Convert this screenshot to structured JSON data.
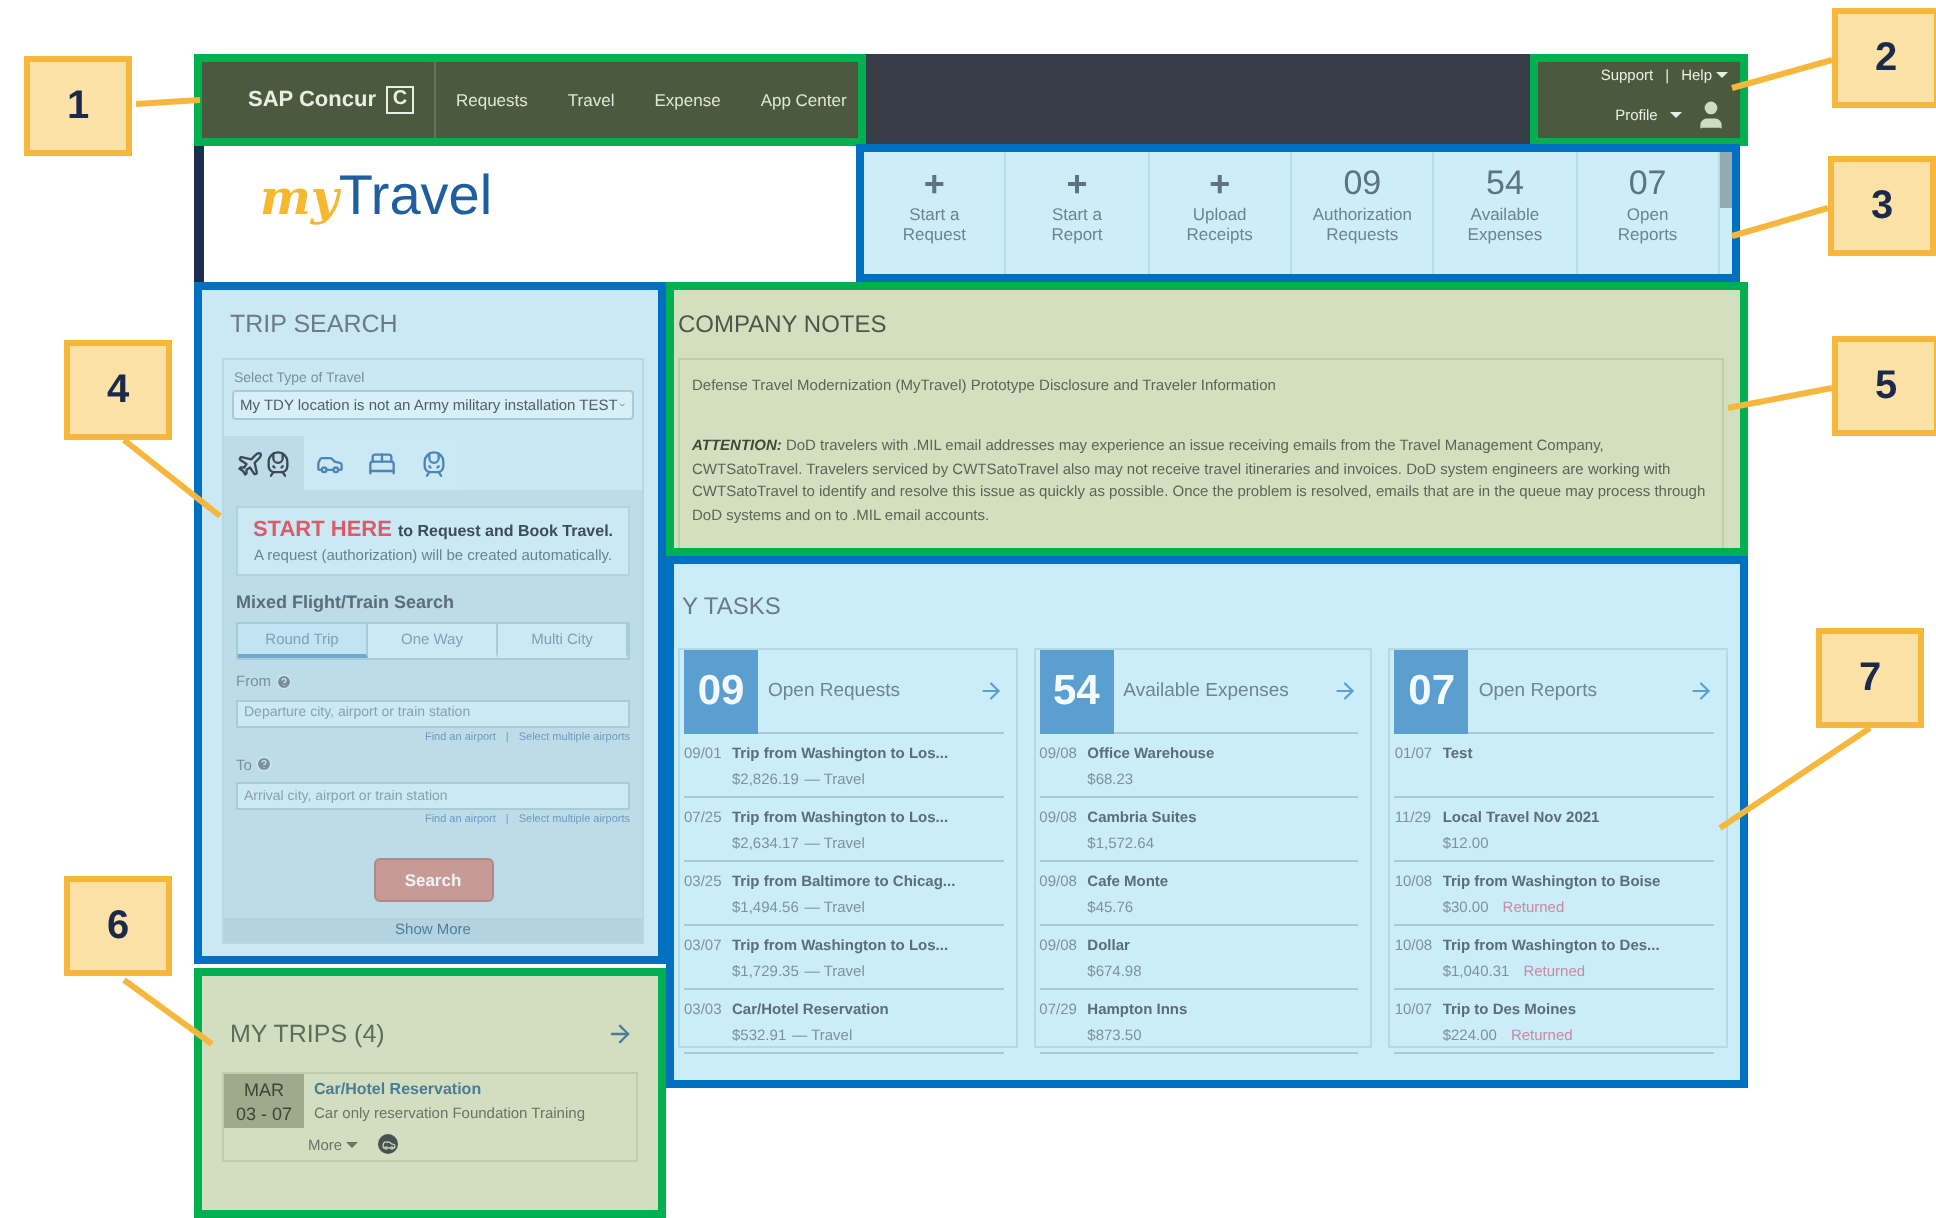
{
  "header": {
    "brand": "SAP Concur",
    "brand_mark": "C",
    "nav": [
      {
        "label": "Requests"
      },
      {
        "label": "Travel"
      },
      {
        "label": "Expense"
      },
      {
        "label": "App Center"
      }
    ],
    "support": "Support",
    "separator": "|",
    "help": "Help",
    "profile": "Profile"
  },
  "logo": {
    "script": "my",
    "word": "Travel"
  },
  "quick_actions": [
    {
      "kind": "add",
      "value": "+",
      "label": [
        "Start a",
        "Request"
      ]
    },
    {
      "kind": "add",
      "value": "+",
      "label": [
        "Start a",
        "Report"
      ]
    },
    {
      "kind": "add",
      "value": "+",
      "label": [
        "Upload",
        "Receipts"
      ]
    },
    {
      "kind": "count",
      "value": "09",
      "label": [
        "Authorization",
        "Requests"
      ]
    },
    {
      "kind": "count",
      "value": "54",
      "label": [
        "Available",
        "Expenses"
      ]
    },
    {
      "kind": "count",
      "value": "07",
      "label": [
        "Open",
        "Reports"
      ]
    }
  ],
  "trip_search": {
    "title": "TRIP SEARCH",
    "type_label": "Select Type of Travel",
    "type_value": "My TDY location is not an Army military installation TEST",
    "modes": [
      {
        "kind": "flight-train",
        "selected": true
      },
      {
        "kind": "car",
        "selected": false
      },
      {
        "kind": "hotel",
        "selected": false
      },
      {
        "kind": "train",
        "selected": false
      }
    ],
    "banner_title": "START HERE",
    "banner_text": "to Request and Book Travel.",
    "banner_note": "A request (authorization) will be created automatically.",
    "subtitle": "Mixed Flight/Train Search",
    "trip_types": [
      {
        "label": "Round Trip",
        "selected": true
      },
      {
        "label": "One Way",
        "selected": false
      },
      {
        "label": "Multi City",
        "selected": false
      }
    ],
    "fields": [
      {
        "label": "From",
        "placeholder": "Departure city, airport or train station",
        "link_1": "Find an airport",
        "separator": "|",
        "link_2": "Select multiple airports"
      },
      {
        "label": "To",
        "placeholder": "Arrival city, airport or train station",
        "link_1": "Find an airport",
        "separator": "|",
        "link_2": "Select multiple airports"
      }
    ],
    "search": "Search",
    "show_more": "Show More"
  },
  "company_notes": {
    "title": "COMPANY NOTES",
    "heading": "Defense Travel Modernization (MyTravel) Prototype Disclosure and Traveler Information",
    "body": "**ATTENTION:** DoD travelers with .MIL email addresses may experience an issue receiving emails from the Travel Management Company, CWTSatoTravel.  Travelers serviced by CWTSatoTravel also may not receive travel itineraries and invoices. DoD system engineers are working with CWTSatoTravel to identify and resolve this issue as quickly as possible. Once the problem is resolved, emails that are in the queue may process through DoD systems and on to .MIL email accounts."
  },
  "tasks": {
    "title": "Y TASKS",
    "cards": [
      {
        "count": "09",
        "title": "Open Requests",
        "items": [
          {
            "date": "09/01",
            "title": "Trip from Washington to Los...",
            "amount": "$2,826.19",
            "note": "— Travel"
          },
          {
            "date": "07/25",
            "title": "Trip from Washington to Los...",
            "amount": "$2,634.17",
            "note": "— Travel"
          },
          {
            "date": "03/25",
            "title": "Trip from Baltimore to Chicag...",
            "amount": "$1,494.56",
            "note": "— Travel"
          },
          {
            "date": "03/07",
            "title": "Trip from Washington to Los...",
            "amount": "$1,729.35",
            "note": "— Travel"
          },
          {
            "date": "03/03",
            "title": "Car/Hotel Reservation",
            "amount": "$532.91",
            "note": "— Travel"
          }
        ]
      },
      {
        "count": "54",
        "title": "Available Expenses",
        "items": [
          {
            "date": "09/08",
            "title": "Office Warehouse",
            "amount": "$68.23"
          },
          {
            "date": "09/08",
            "title": "Cambria Suites",
            "amount": "$1,572.64"
          },
          {
            "date": "09/08",
            "title": "Cafe Monte",
            "amount": "$45.76"
          },
          {
            "date": "09/08",
            "title": "Dollar",
            "amount": "$674.98"
          },
          {
            "date": "07/29",
            "title": "Hampton Inns",
            "amount": "$873.50"
          }
        ]
      },
      {
        "count": "07",
        "title": "Open Reports",
        "items": [
          {
            "date": "01/07",
            "title": "Test"
          },
          {
            "date": "11/29",
            "title": "Local Travel Nov 2021",
            "amount": "$12.00"
          },
          {
            "date": "10/08",
            "title": "Trip from Washington to Boise",
            "amount": "$30.00",
            "status": "Returned"
          },
          {
            "date": "10/08",
            "title": "Trip from Washington to Des...",
            "amount": "$1,040.31",
            "status": "Returned"
          },
          {
            "date": "10/07",
            "title": "Trip to Des Moines",
            "amount": "$224.00",
            "status": "Returned"
          }
        ]
      }
    ]
  },
  "my_trips": {
    "title": "MY TRIPS (4)",
    "trip": {
      "month": "MAR",
      "days": "03 - 07",
      "title": "Car/Hotel Reservation",
      "subtitle": "Car only reservation Foundation Training",
      "more": "More"
    }
  },
  "callouts": [
    {
      "label": "1",
      "color": "#00b050"
    },
    {
      "label": "2",
      "color": "#00b050"
    },
    {
      "label": "3",
      "color": "#0070c0"
    },
    {
      "label": "4",
      "color": "#0070c0"
    },
    {
      "label": "5",
      "color": "#00b050"
    },
    {
      "label": "6",
      "color": "#00b050"
    },
    {
      "label": "7",
      "color": "#0070c0"
    }
  ]
}
